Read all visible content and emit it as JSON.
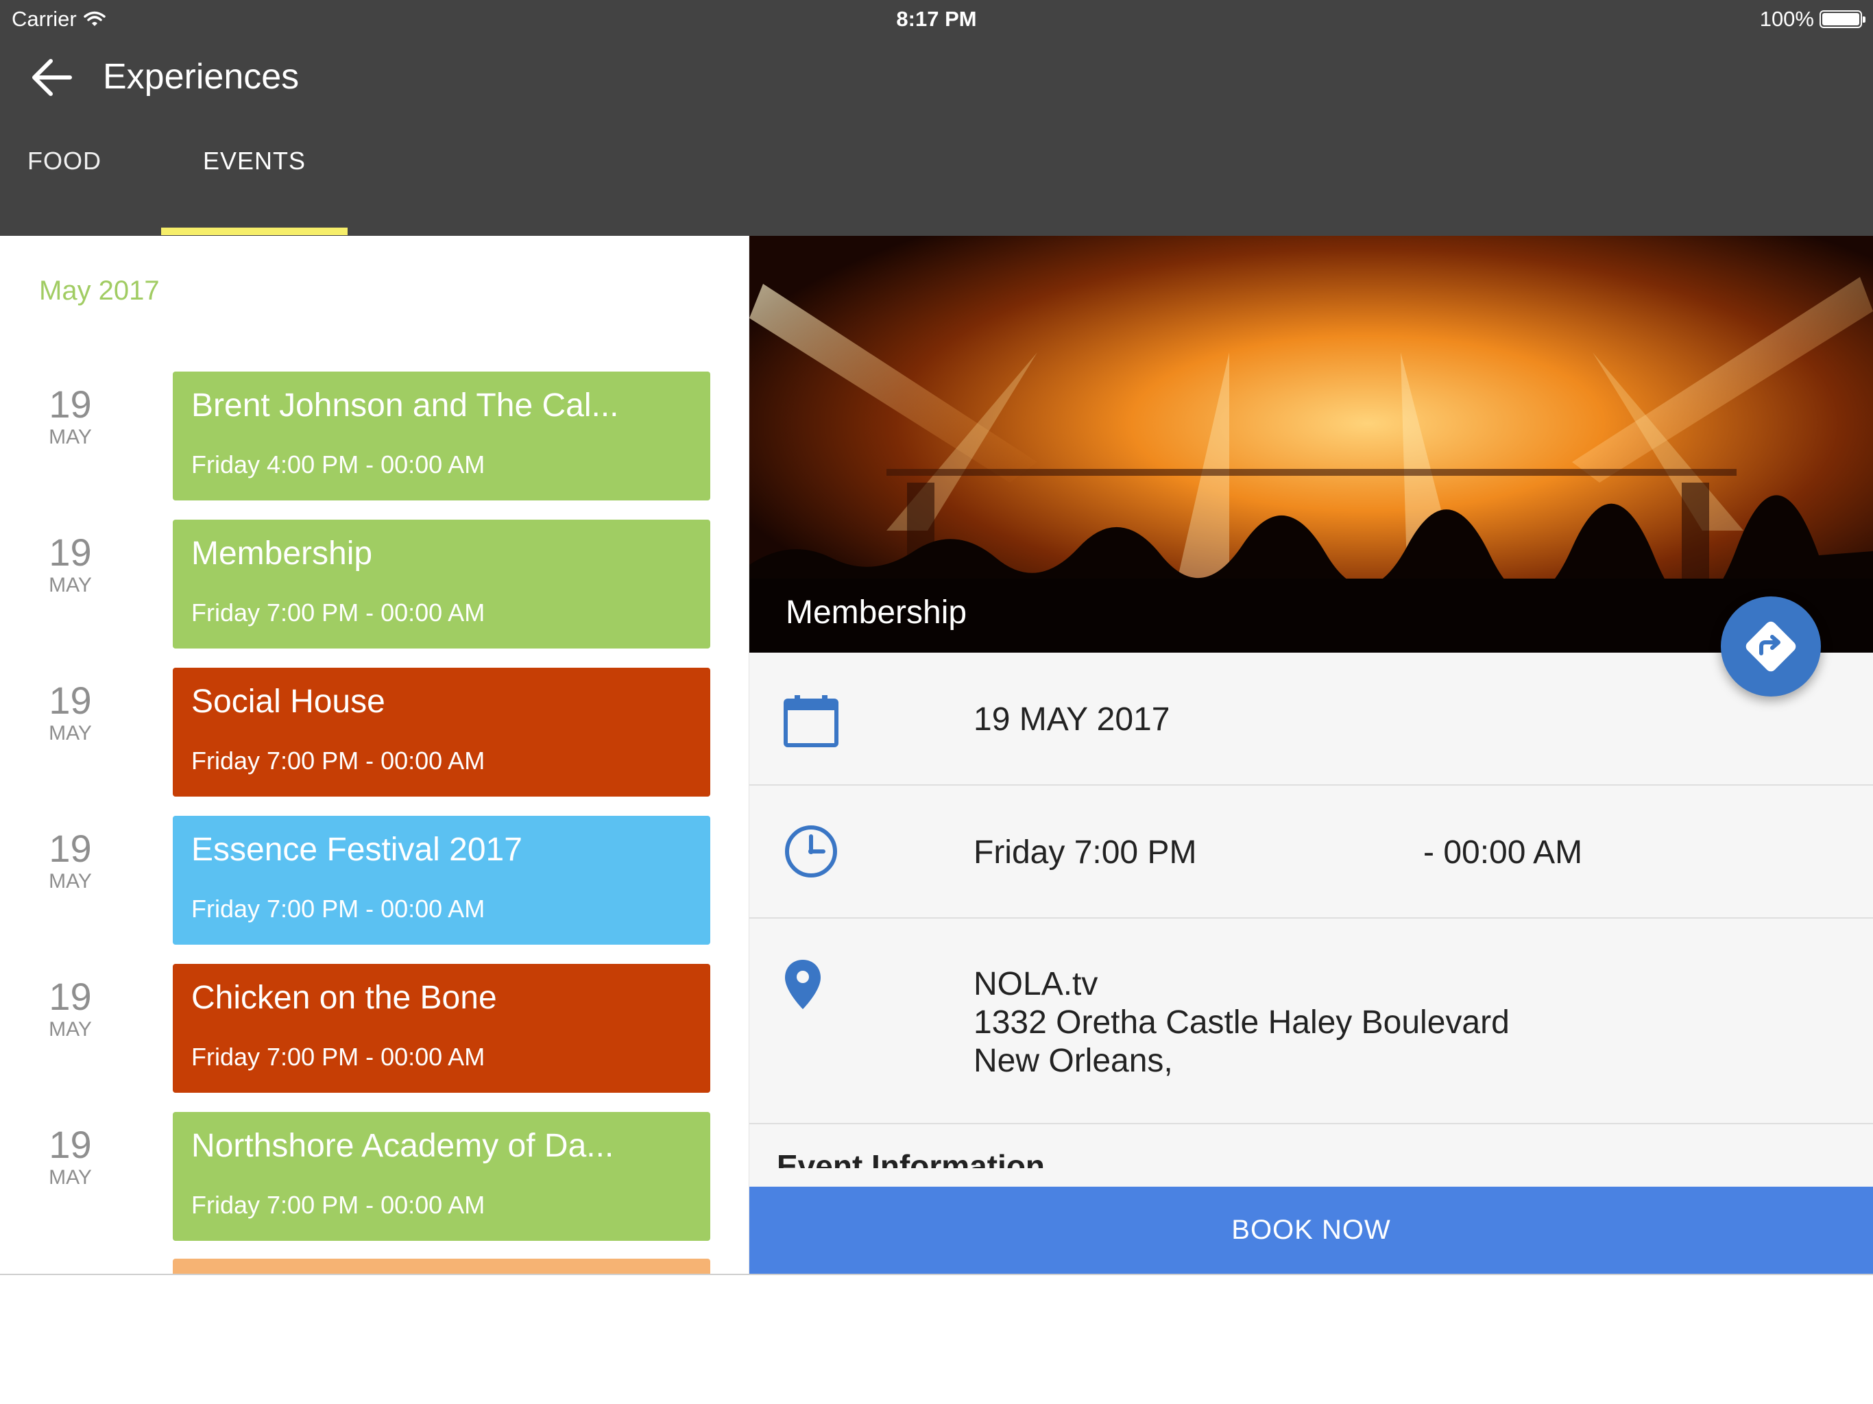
{
  "status_bar": {
    "carrier": "Carrier",
    "time": "8:17 PM",
    "battery": "100%"
  },
  "header": {
    "title": "Experiences",
    "tabs": [
      {
        "label": "FOOD",
        "selected": false
      },
      {
        "label": "EVENTS",
        "selected": true
      }
    ]
  },
  "events_list": {
    "month_label": "May 2017",
    "items": [
      {
        "day": "19",
        "month": "MAY",
        "name": "Brent Johnson and The Cal...",
        "when": "Friday 4:00 PM - 00:00 AM",
        "color": "#a0cd63"
      },
      {
        "day": "19",
        "month": "MAY",
        "name": "Membership",
        "when": "Friday 7:00 PM - 00:00 AM",
        "color": "#a0cd63"
      },
      {
        "day": "19",
        "month": "MAY",
        "name": "Social House",
        "when": "Friday 7:00 PM - 00:00 AM",
        "color": "#c63e05"
      },
      {
        "day": "19",
        "month": "MAY",
        "name": "Essence Festival 2017",
        "when": "Friday 7:00 PM - 00:00 AM",
        "color": "#5bc1f2"
      },
      {
        "day": "19",
        "month": "MAY",
        "name": "Chicken on the Bone",
        "when": "Friday 7:00 PM - 00:00 AM",
        "color": "#c63e05"
      },
      {
        "day": "19",
        "month": "MAY",
        "name": "Northshore Academy of Da...",
        "when": "Friday 7:00 PM - 00:00 AM",
        "color": "#a0cd63"
      }
    ]
  },
  "detail": {
    "title": "Membership",
    "date": "19 MAY 2017",
    "time_start": "Friday 7:00 PM",
    "time_end": "- 00:00 AM",
    "venue": "NOLA.tv",
    "address_line1": "1332 Oretha Castle Haley Boulevard",
    "address_line2": "New Orleans,",
    "section_heading": "Event Information",
    "book_label": "BOOK NOW",
    "accent_color": "#3a76c5",
    "icons": [
      "calendar-icon",
      "clock-icon",
      "location-pin-icon",
      "directions-icon"
    ]
  }
}
